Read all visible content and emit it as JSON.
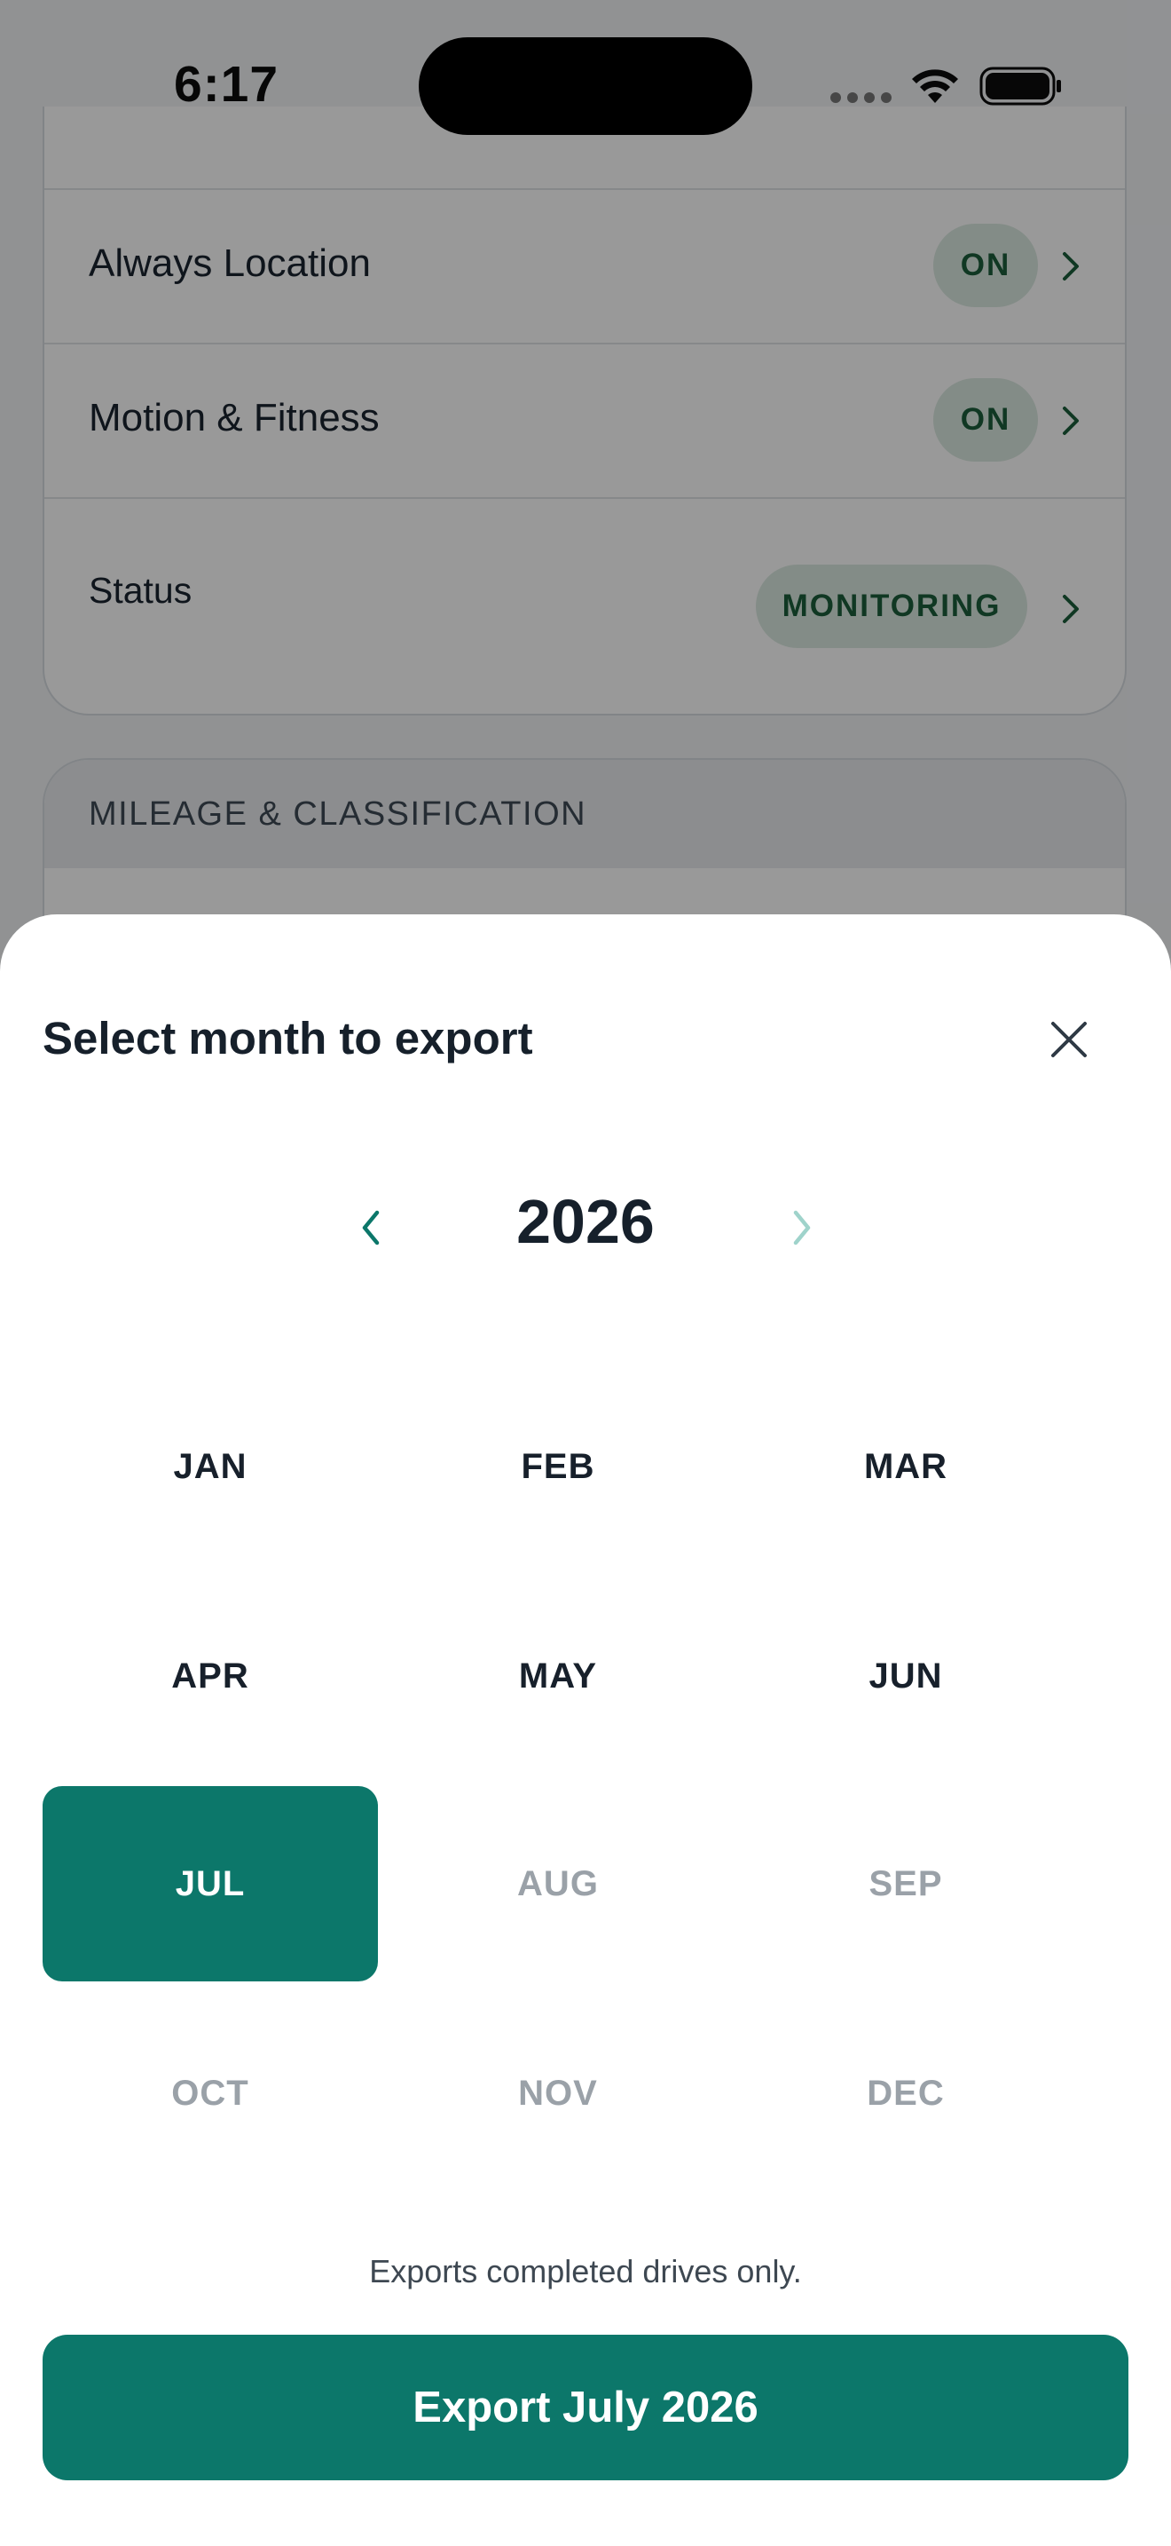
{
  "status_bar": {
    "time": "6:17"
  },
  "permissions": {
    "rows": [
      {
        "label": "Always Location",
        "value": "ON"
      },
      {
        "label": "Motion & Fitness",
        "value": "ON"
      },
      {
        "label": "Status",
        "value": "MONITORING"
      }
    ]
  },
  "mileage": {
    "header": "MILEAGE & CLASSIFICATION"
  },
  "sheet": {
    "title": "Select month to export",
    "year": "2026",
    "months": [
      {
        "label": "JAN",
        "state": "enabled"
      },
      {
        "label": "FEB",
        "state": "enabled"
      },
      {
        "label": "MAR",
        "state": "enabled"
      },
      {
        "label": "APR",
        "state": "enabled"
      },
      {
        "label": "MAY",
        "state": "enabled"
      },
      {
        "label": "JUN",
        "state": "enabled"
      },
      {
        "label": "JUL",
        "state": "selected"
      },
      {
        "label": "AUG",
        "state": "disabled"
      },
      {
        "label": "SEP",
        "state": "disabled"
      },
      {
        "label": "OCT",
        "state": "disabled"
      },
      {
        "label": "NOV",
        "state": "disabled"
      },
      {
        "label": "DEC",
        "state": "disabled"
      }
    ],
    "footnote": "Exports completed drives only.",
    "export_label": "Export July 2026"
  },
  "icons": {
    "close": "close-icon",
    "prev": "chevron-left-icon",
    "next": "chevron-right-icon",
    "row_chevron": "chevron-right-icon",
    "wifi": "wifi-icon",
    "battery": "battery-icon"
  },
  "colors": {
    "accent": "#0c776a",
    "pill_bg": "#dbe9e1",
    "pill_text": "#1b5e3b",
    "disabled_month": "#9aa1a8",
    "next_arrow_disabled": "#9fd3cb"
  }
}
